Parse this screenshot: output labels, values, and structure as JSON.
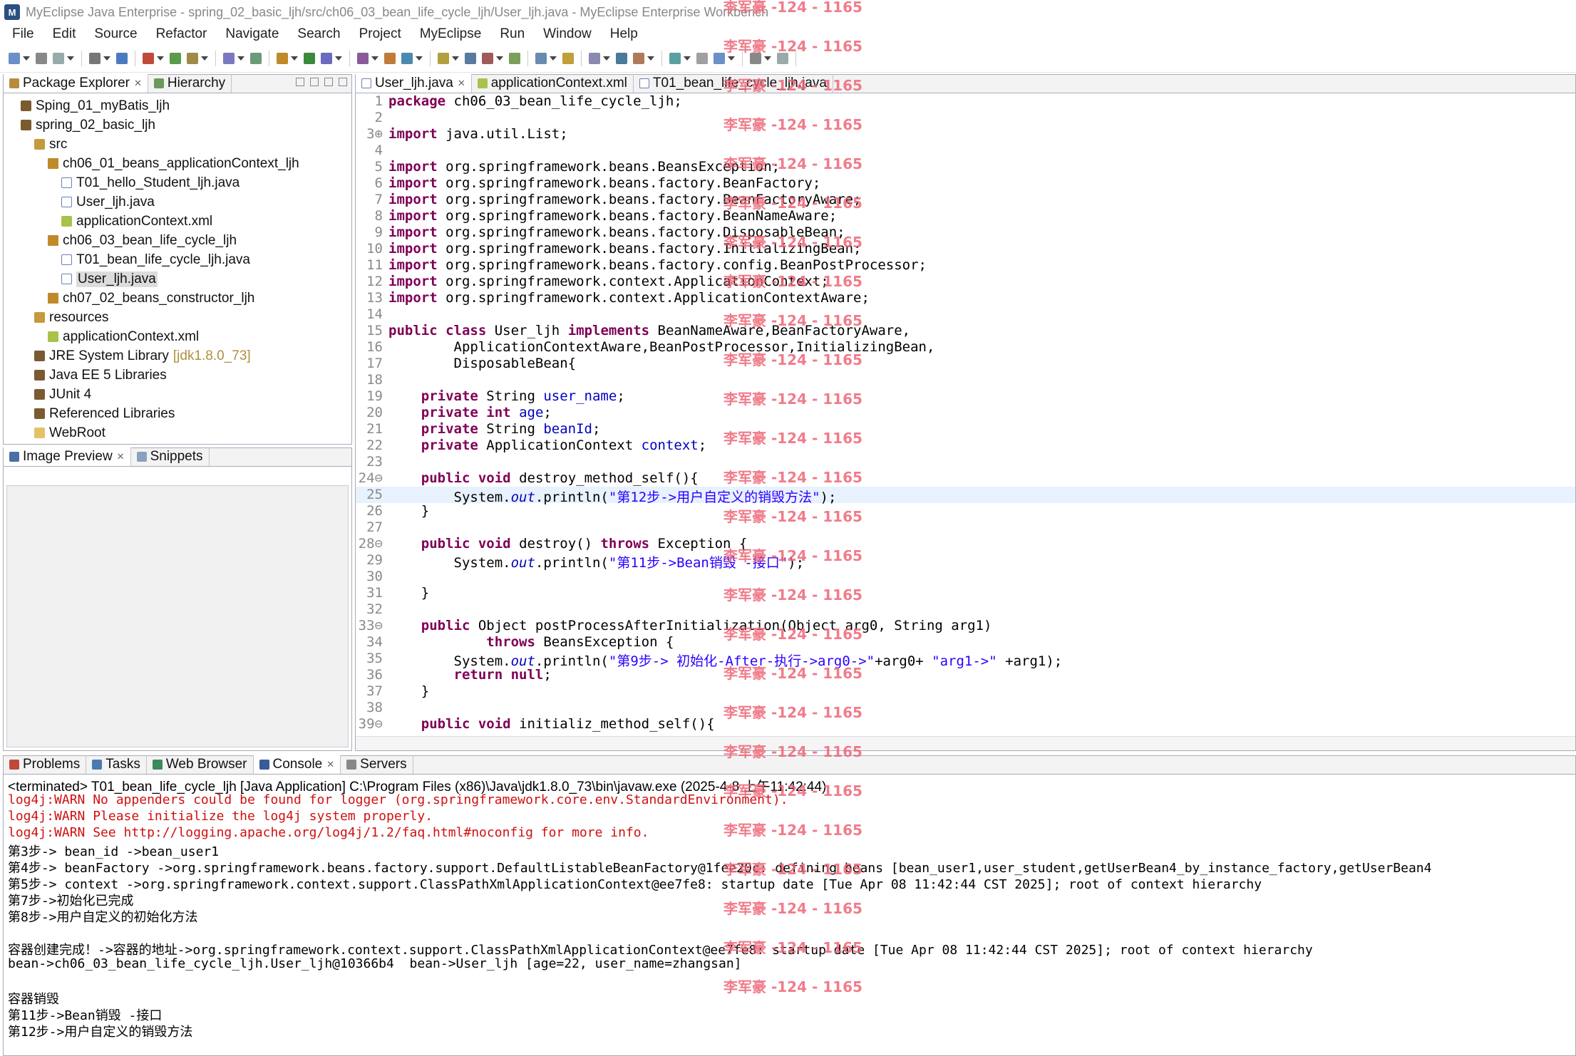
{
  "window": {
    "title": "MyEclipse Java Enterprise - spring_02_basic_ljh/src/ch06_03_bean_life_cycle_ljh/User_ljh.java - MyEclipse Enterprise Workbench"
  },
  "menu": [
    "File",
    "Edit",
    "Source",
    "Refactor",
    "Navigate",
    "Search",
    "Project",
    "MyEclipse",
    "Run",
    "Window",
    "Help"
  ],
  "package_explorer": {
    "tabs": [
      "Package Explorer",
      "Hierarchy"
    ],
    "tree": [
      {
        "label": "Sping_01_myBatis_ljh",
        "indent": 0,
        "icon": "proj"
      },
      {
        "label": "spring_02_basic_ljh",
        "indent": 0,
        "icon": "proj"
      },
      {
        "label": "src",
        "indent": 1,
        "icon": "src"
      },
      {
        "label": "ch06_01_beans_applicationContext_ljh",
        "indent": 2,
        "icon": "pkg"
      },
      {
        "label": "T01_hello_Student_ljh.java",
        "indent": 3,
        "icon": "java"
      },
      {
        "label": "User_ljh.java",
        "indent": 3,
        "icon": "java"
      },
      {
        "label": "applicationContext.xml",
        "indent": 3,
        "icon": "xml"
      },
      {
        "label": "ch06_03_bean_life_cycle_ljh",
        "indent": 2,
        "icon": "pkg"
      },
      {
        "label": "T01_bean_life_cycle_ljh.java",
        "indent": 3,
        "icon": "java"
      },
      {
        "label": "User_ljh.java",
        "indent": 3,
        "icon": "java",
        "selected": true
      },
      {
        "label": "ch07_02_beans_constructor_ljh",
        "indent": 2,
        "icon": "pkg"
      },
      {
        "label": "resources",
        "indent": 1,
        "icon": "src"
      },
      {
        "label": "applicationContext.xml",
        "indent": 2,
        "icon": "xml"
      },
      {
        "label": "JRE System Library",
        "indent": 1,
        "icon": "lib",
        "extra": "[jdk1.8.0_73]"
      },
      {
        "label": "Java EE 5 Libraries",
        "indent": 1,
        "icon": "lib"
      },
      {
        "label": "JUnit 4",
        "indent": 1,
        "icon": "lib"
      },
      {
        "label": "Referenced Libraries",
        "indent": 1,
        "icon": "lib"
      },
      {
        "label": "WebRoot",
        "indent": 1,
        "icon": "folder"
      }
    ]
  },
  "image_preview": {
    "tabs": [
      "Image Preview",
      "Snippets"
    ]
  },
  "editor": {
    "tabs": [
      "User_ljh.java",
      "applicationContext.xml",
      "T01_bean_life_cycle_ljh.java"
    ],
    "lines": [
      {
        "n": "1",
        "t": "<k>package</k> ch06_03_bean_life_cycle_ljh;"
      },
      {
        "n": "2",
        "t": ""
      },
      {
        "n": "3⊕",
        "t": "<k>import</k> java.util.List;"
      },
      {
        "n": "4",
        "t": ""
      },
      {
        "n": "5",
        "t": "<k>import</k> org.springframework.beans.BeansException;"
      },
      {
        "n": "6",
        "t": "<k>import</k> org.springframework.beans.factory.BeanFactory;"
      },
      {
        "n": "7",
        "t": "<k>import</k> org.springframework.beans.factory.BeanFactoryAware;"
      },
      {
        "n": "8",
        "t": "<k>import</k> org.springframework.beans.factory.BeanNameAware;"
      },
      {
        "n": "9",
        "t": "<k>import</k> org.springframework.beans.factory.DisposableBean;"
      },
      {
        "n": "10",
        "t": "<k>import</k> org.springframework.beans.factory.InitializingBean;"
      },
      {
        "n": "11",
        "t": "<k>import</k> org.springframework.beans.factory.config.BeanPostProcessor;"
      },
      {
        "n": "12",
        "t": "<k>import</k> org.springframework.context.ApplicationContext;"
      },
      {
        "n": "13",
        "t": "<k>import</k> org.springframework.context.ApplicationContextAware;"
      },
      {
        "n": "14",
        "t": ""
      },
      {
        "n": "15",
        "t": "<k>public</k> <k>class</k> User_ljh <k>implements</k> BeanNameAware,BeanFactoryAware,"
      },
      {
        "n": "16",
        "t": "        ApplicationContextAware,BeanPostProcessor,InitializingBean,"
      },
      {
        "n": "17",
        "t": "        DisposableBean{"
      },
      {
        "n": "18",
        "t": ""
      },
      {
        "n": "19",
        "t": "    <k>private</k> String <f>user_name</f>;"
      },
      {
        "n": "20",
        "t": "    <k>private</k> <k>int</k> <f>age</f>;"
      },
      {
        "n": "21",
        "t": "    <k>private</k> String <f>beanId</f>;"
      },
      {
        "n": "22",
        "t": "    <k>private</k> ApplicationContext <f>context</f>;"
      },
      {
        "n": "23",
        "t": ""
      },
      {
        "n": "24⊖",
        "t": "    <k>public</k> <k>void</k> destroy_method_self(){"
      },
      {
        "n": "25",
        "t": "        System.<i>out</i>.println(<s>\"第12步->用户自定义的销毁方法\"</s>);",
        "hl": true
      },
      {
        "n": "26",
        "t": "    }"
      },
      {
        "n": "27",
        "t": ""
      },
      {
        "n": "28⊖",
        "t": "    <k>public</k> <k>void</k> destroy() <k>throws</k> Exception {"
      },
      {
        "n": "29",
        "t": "        System.<i>out</i>.println(<s>\"第11步->Bean销毁 -接口\"</s>);"
      },
      {
        "n": "30",
        "t": ""
      },
      {
        "n": "31",
        "t": "    }"
      },
      {
        "n": "32",
        "t": ""
      },
      {
        "n": "33⊖",
        "t": "    <k>public</k> Object postProcessAfterInitialization(Object arg0, String arg1)"
      },
      {
        "n": "34",
        "t": "            <k>throws</k> BeansException {"
      },
      {
        "n": "35",
        "t": "        System.<i>out</i>.println(<s>\"第9步-> 初始化-After-执行->arg0->\"</s>+arg0+ <s>\"arg1->\"</s> +arg1);"
      },
      {
        "n": "36",
        "t": "        <k>return</k> <k>null</k>;"
      },
      {
        "n": "37",
        "t": "    }"
      },
      {
        "n": "38",
        "t": ""
      },
      {
        "n": "39⊖",
        "t": "    <k>public</k> <k>void</k> initializ_method_self(){"
      }
    ]
  },
  "bottom": {
    "tabs": [
      "Problems",
      "Tasks",
      "Web Browser",
      "Console",
      "Servers"
    ],
    "terminated": "<terminated> T01_bean_life_cycle_ljh [Java Application] C:\\Program Files (x86)\\Java\\jdk1.8.0_73\\bin\\javaw.exe (2025-4-8 上午11:42:44)",
    "lines": [
      {
        "t": "log4j:WARN No appenders could be found for logger (org.springframework.core.env.StandardEnvironment).",
        "warn": true
      },
      {
        "t": "log4j:WARN Please initialize the log4j system properly.",
        "warn": true
      },
      {
        "t": "log4j:WARN See http://logging.apache.org/log4j/1.2/faq.html#noconfig for more info.",
        "warn": true
      },
      {
        "t": "第3步-> bean_id ->bean_user1"
      },
      {
        "t": "第4步-> beanFactory ->org.springframework.beans.factory.support.DefaultListableBeanFactory@1fee20c: defining beans [bean_user1,user_student,getUserBean4_by_instance_factory,getUserBean4"
      },
      {
        "t": "第5步-> context ->org.springframework.context.support.ClassPathXmlApplicationContext@ee7fe8: startup date [Tue Apr 08 11:42:44 CST 2025]; root of context hierarchy"
      },
      {
        "t": "第7步->初始化已完成"
      },
      {
        "t": "第8步->用户自定义的初始化方法"
      },
      {
        "t": ""
      },
      {
        "t": "容器创建完成！->容器的地址->org.springframework.context.support.ClassPathXmlApplicationContext@ee7fe8: startup date [Tue Apr 08 11:42:44 CST 2025]; root of context hierarchy"
      },
      {
        "t": "bean->ch06_03_bean_life_cycle_ljh.User_ljh@10366b4  bean->User_ljh [age=22, user_name=zhangsan]"
      },
      {
        "t": ""
      },
      {
        "t": "容器销毁"
      },
      {
        "t": "第11步->Bean销毁 -接口"
      },
      {
        "t": "第12步->用户自定义的销毁方法"
      }
    ]
  },
  "watermark": "李军豪 -124 - 1165",
  "colors": {
    "keyword": "#7f0055",
    "string": "#2a00ff",
    "field": "#0000c0",
    "warn": "#d01010",
    "watermark": "#ee6677"
  }
}
